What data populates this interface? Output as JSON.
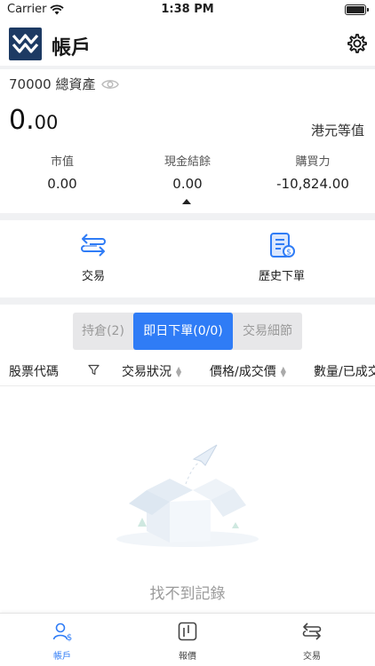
{
  "status_bar": {
    "carrier": "Carrier",
    "time": "1:38 PM"
  },
  "header": {
    "title": "帳戶"
  },
  "summary": {
    "asset_label": "70000 總資產",
    "amount_int": "0.",
    "amount_dec": "00",
    "currency_label": "港元等值",
    "stats": [
      {
        "label": "市值",
        "value": "0.00"
      },
      {
        "label": "現金結餘",
        "value": "0.00"
      },
      {
        "label": "購買力",
        "value": "-10,824.00"
      }
    ]
  },
  "actions": [
    {
      "label": "交易",
      "icon": "swap-arrows-icon"
    },
    {
      "label": "歷史下單",
      "icon": "order-history-icon"
    }
  ],
  "segments": [
    {
      "label": "持倉(2)",
      "active": false
    },
    {
      "label": "即日下單(0/0)",
      "active": true
    },
    {
      "label": "交易細節",
      "active": false
    }
  ],
  "table": {
    "columns": [
      "股票代碼",
      "交易狀況",
      "價格/成交價",
      "數量/已成交"
    ]
  },
  "empty_state": {
    "message": "找不到記錄",
    "icon": "empty-box-icon"
  },
  "tab_bar": [
    {
      "label": "帳戶",
      "icon": "account-icon",
      "active": true
    },
    {
      "label": "報價",
      "icon": "quote-icon",
      "active": false
    },
    {
      "label": "交易",
      "icon": "trade-icon",
      "active": false
    }
  ],
  "colors": {
    "accent": "#2f7cf6",
    "logo": "#1d3a63",
    "divider": "#f0f1f3"
  }
}
